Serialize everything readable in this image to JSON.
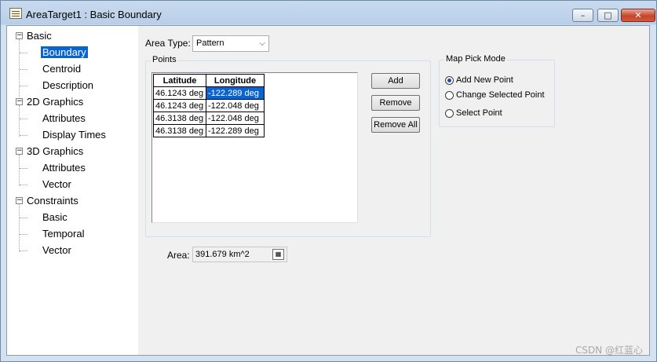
{
  "window": {
    "title": "AreaTarget1 : Basic Boundary",
    "controls": {
      "minimize": "–",
      "maximize": "□",
      "close": "✕"
    }
  },
  "tree": {
    "groups": [
      {
        "label": "Basic",
        "expander": "−",
        "children": [
          "Boundary",
          "Centroid",
          "Description"
        ]
      },
      {
        "label": "2D Graphics",
        "expander": "−",
        "children": [
          "Attributes",
          "Display Times"
        ]
      },
      {
        "label": "3D Graphics",
        "expander": "−",
        "children": [
          "Attributes",
          "Vector"
        ]
      },
      {
        "label": "Constraints",
        "expander": "−",
        "children": [
          "Basic",
          "Temporal",
          "Vector"
        ]
      }
    ],
    "selected": "Boundary"
  },
  "form": {
    "area_type_label": "Area Type:",
    "area_type_value": "Pattern",
    "points_group_label": "Points",
    "points_table": {
      "headers": [
        "Latitude",
        "Longitude"
      ],
      "rows": [
        [
          "46.1243 deg",
          "-122.289 deg"
        ],
        [
          "46.1243 deg",
          "-122.048 deg"
        ],
        [
          "46.3138 deg",
          "-122.048 deg"
        ],
        [
          "46.3138 deg",
          "-122.289 deg"
        ]
      ],
      "highlighted_cell": "row 1, Longitude"
    },
    "buttons": {
      "add": "Add",
      "remove": "Remove",
      "remove_all": "Remove All"
    },
    "map_pick_mode": {
      "label": "Map Pick Mode",
      "options": [
        "Add New Point",
        "Change Selected Point",
        "Select Point"
      ],
      "selected": "Add New Point"
    },
    "area_label": "Area:",
    "area_value": "391.679 km^2"
  },
  "watermark": "CSDN @红蓝心",
  "colors": {
    "selection": "#0a64d0",
    "panel_bg": "#f0f0f0",
    "title_bar": "#c8daee"
  }
}
